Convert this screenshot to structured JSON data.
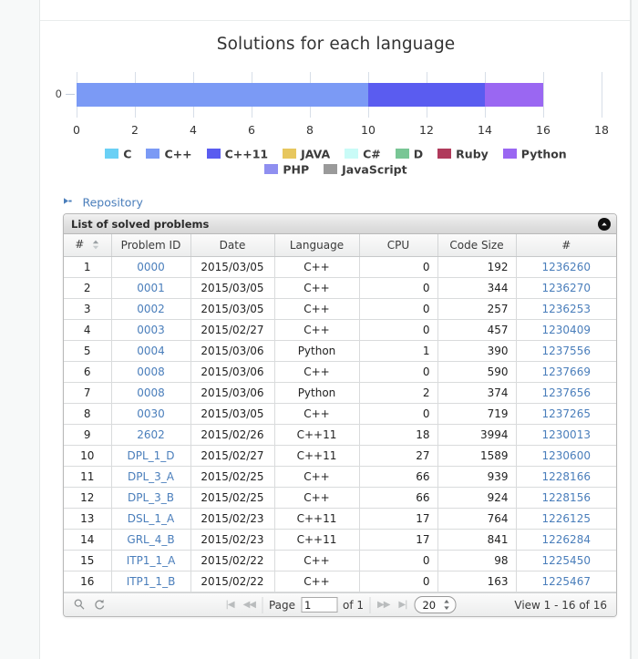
{
  "chart_data": {
    "type": "bar",
    "orientation": "horizontal",
    "title": "Solutions for each language",
    "xlabel": "",
    "ylabel": "",
    "categories": [
      "0"
    ],
    "xlim": [
      0,
      18
    ],
    "xticks": [
      0,
      2,
      4,
      6,
      8,
      10,
      12,
      14,
      16,
      18
    ],
    "yticks": [
      "0"
    ],
    "grid": true,
    "stacked": true,
    "legend_position": "bottom",
    "series": [
      {
        "name": "C",
        "values": [
          0
        ],
        "color": "#6ad0f5"
      },
      {
        "name": "C++",
        "values": [
          10
        ],
        "color": "#7b9af5"
      },
      {
        "name": "C++11",
        "values": [
          4
        ],
        "color": "#5a5cf0"
      },
      {
        "name": "JAVA",
        "values": [
          0
        ],
        "color": "#e7c75f"
      },
      {
        "name": "C#",
        "values": [
          0
        ],
        "color": "#c9fbf7"
      },
      {
        "name": "D",
        "values": [
          0
        ],
        "color": "#79c695"
      },
      {
        "name": "Ruby",
        "values": [
          0
        ],
        "color": "#b03a5b"
      },
      {
        "name": "Python",
        "values": [
          2
        ],
        "color": "#9a67f2"
      },
      {
        "name": "PHP",
        "values": [
          0
        ],
        "color": "#8f8ff0"
      },
      {
        "name": "JavaScript",
        "values": [
          0
        ],
        "color": "#9a9a9a"
      }
    ]
  },
  "repository": {
    "label": "Repository",
    "icon": "arrow-right-icon"
  },
  "panel": {
    "title": "List of solved problems",
    "collapse_icon": "chevron-up-icon"
  },
  "table": {
    "columns": [
      "#",
      "Problem ID",
      "Date",
      "Language",
      "CPU",
      "Code Size",
      "#"
    ],
    "sort_column": "#",
    "sort_icon": "sort-updown-icon",
    "rows": [
      {
        "num": "1",
        "problem_id": "0000",
        "date": "2015/03/05",
        "language": "C++",
        "cpu": "0",
        "code_size": "192",
        "id": "1236260"
      },
      {
        "num": "2",
        "problem_id": "0001",
        "date": "2015/03/05",
        "language": "C++",
        "cpu": "0",
        "code_size": "344",
        "id": "1236270"
      },
      {
        "num": "3",
        "problem_id": "0002",
        "date": "2015/03/05",
        "language": "C++",
        "cpu": "0",
        "code_size": "257",
        "id": "1236253"
      },
      {
        "num": "4",
        "problem_id": "0003",
        "date": "2015/02/27",
        "language": "C++",
        "cpu": "0",
        "code_size": "457",
        "id": "1230409"
      },
      {
        "num": "5",
        "problem_id": "0004",
        "date": "2015/03/06",
        "language": "Python",
        "cpu": "1",
        "code_size": "390",
        "id": "1237556"
      },
      {
        "num": "6",
        "problem_id": "0008",
        "date": "2015/03/06",
        "language": "C++",
        "cpu": "0",
        "code_size": "590",
        "id": "1237669"
      },
      {
        "num": "7",
        "problem_id": "0008",
        "date": "2015/03/06",
        "language": "Python",
        "cpu": "2",
        "code_size": "374",
        "id": "1237656"
      },
      {
        "num": "8",
        "problem_id": "0030",
        "date": "2015/03/05",
        "language": "C++",
        "cpu": "0",
        "code_size": "719",
        "id": "1237265"
      },
      {
        "num": "9",
        "problem_id": "2602",
        "date": "2015/02/26",
        "language": "C++11",
        "cpu": "18",
        "code_size": "3994",
        "id": "1230013"
      },
      {
        "num": "10",
        "problem_id": "DPL_1_D",
        "date": "2015/02/27",
        "language": "C++11",
        "cpu": "27",
        "code_size": "1589",
        "id": "1230600"
      },
      {
        "num": "11",
        "problem_id": "DPL_3_A",
        "date": "2015/02/25",
        "language": "C++",
        "cpu": "66",
        "code_size": "939",
        "id": "1228166"
      },
      {
        "num": "12",
        "problem_id": "DPL_3_B",
        "date": "2015/02/25",
        "language": "C++",
        "cpu": "66",
        "code_size": "924",
        "id": "1228156"
      },
      {
        "num": "13",
        "problem_id": "DSL_1_A",
        "date": "2015/02/23",
        "language": "C++11",
        "cpu": "17",
        "code_size": "764",
        "id": "1226125"
      },
      {
        "num": "14",
        "problem_id": "GRL_4_B",
        "date": "2015/02/23",
        "language": "C++11",
        "cpu": "17",
        "code_size": "841",
        "id": "1226284"
      },
      {
        "num": "15",
        "problem_id": "ITP1_1_A",
        "date": "2015/02/22",
        "language": "C++",
        "cpu": "0",
        "code_size": "98",
        "id": "1225450"
      },
      {
        "num": "16",
        "problem_id": "ITP1_1_B",
        "date": "2015/02/22",
        "language": "C++",
        "cpu": "0",
        "code_size": "163",
        "id": "1225467"
      }
    ]
  },
  "footer": {
    "search_icon": "search-icon",
    "refresh_icon": "refresh-icon",
    "first_page_icon": "first-page-icon",
    "prev_page_icon": "prev-page-icon",
    "next_page_icon": "next-page-icon",
    "last_page_icon": "last-page-icon",
    "page_label": "Page",
    "page_value": "1",
    "of_label": "of 1",
    "page_size": "20",
    "page_size_options": [
      "20"
    ],
    "view_status": "View 1 - 16 of 16"
  },
  "colors": {
    "link": "#4a7ebb",
    "panel_border": "#b8b8b8",
    "grid_line": "#d7dee8",
    "page_bg": "#f7f9f9"
  }
}
